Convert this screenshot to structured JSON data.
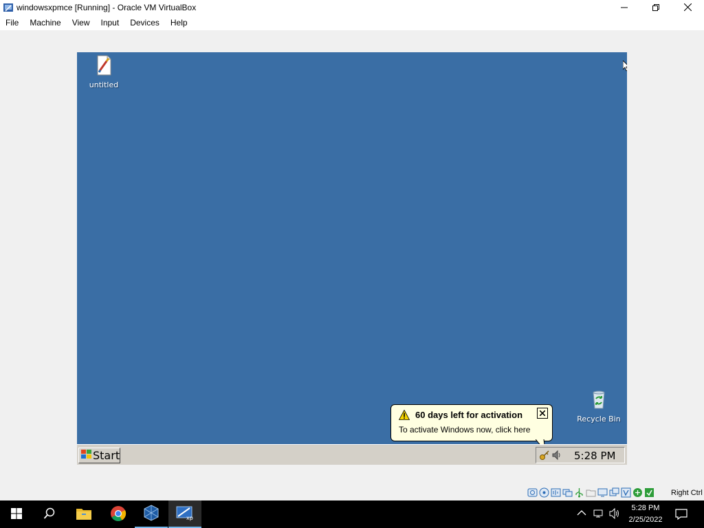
{
  "window": {
    "title": "windowsxpmce [Running] - Oracle VM VirtualBox",
    "icon": "virtualbox-vm-icon",
    "controls": [
      "minimize-icon",
      "maximize-icon",
      "close-icon"
    ]
  },
  "menu": {
    "items": [
      "File",
      "Machine",
      "View",
      "Input",
      "Devices",
      "Help"
    ]
  },
  "guest": {
    "desktop": {
      "background": "#3a6ea5",
      "icons": [
        {
          "label": "untitled",
          "icon": "paint-file-icon"
        },
        {
          "label": "Recycle Bin",
          "icon": "recycle-bin-icon"
        }
      ]
    },
    "taskbar": {
      "start_label": "Start",
      "clock": "5:28 PM",
      "tray_icons": [
        "activation-key-icon",
        "speaker-icon"
      ]
    },
    "balloon": {
      "title": "60 days left for activation",
      "text": "To activate Windows now, click here",
      "icon": "warning-icon"
    }
  },
  "statusbar": {
    "icons": [
      "hard-disk-icon",
      "optical-drive-icon",
      "audio-icon",
      "network-icon",
      "usb-icon",
      "shared-folders-icon",
      "display-icon",
      "recording-icon",
      "cpu-icon",
      "mouse-integration-icon",
      "keyboard-icon"
    ],
    "host_key": "Right Ctrl"
  },
  "host_taskbar": {
    "apps": [
      "start-icon",
      "search-icon",
      "file-explorer-icon",
      "chrome-icon",
      "virtualbox-icon",
      "windows-xp-vm-icon"
    ],
    "time": "5:28 PM",
    "date": "2/25/2022",
    "tray": [
      "chevron-up-icon",
      "network-icon",
      "volume-icon",
      "notification-icon"
    ]
  },
  "colors": {
    "xp_desktop": "#3a6ea5",
    "xp_taskbar": "#d4d0c8",
    "balloon": "#ffffe1",
    "host_taskbar": "#000000"
  }
}
